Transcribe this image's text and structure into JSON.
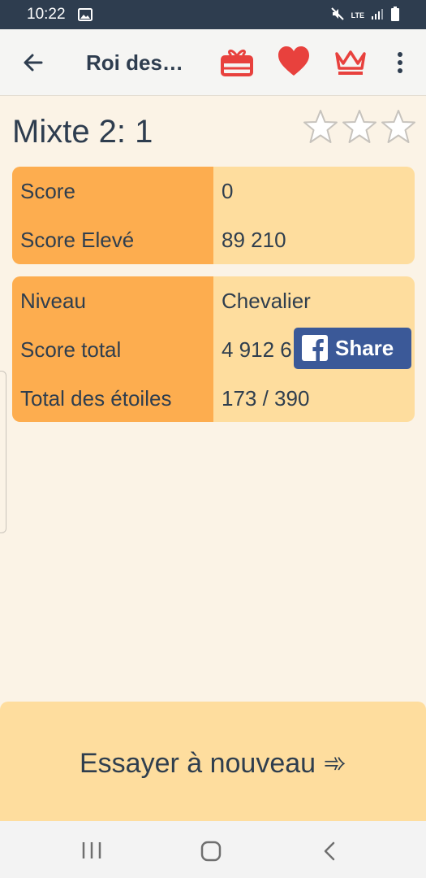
{
  "status_bar": {
    "time": "10:22",
    "network": "LTE",
    "icons": [
      "gallery-icon",
      "mute-icon",
      "signal-icon",
      "battery-icon"
    ]
  },
  "app_bar": {
    "title": "Roi des…",
    "icons": [
      "back-arrow-icon",
      "gift-icon",
      "heart-icon",
      "crown-icon",
      "more-vert-icon"
    ],
    "accent_color": "#e8413d"
  },
  "level": {
    "title": "Mixte 2: 1",
    "stars_earned": 0,
    "stars_total": 3
  },
  "score_card": {
    "rows": [
      {
        "label": "Score",
        "value": "0"
      },
      {
        "label": "Score Elevé",
        "value": "89 210"
      }
    ]
  },
  "stats_card": {
    "rows": [
      {
        "label": "Niveau",
        "value": "Chevalier"
      },
      {
        "label": "Score total",
        "value": "4 912 6"
      },
      {
        "label": "Total des étoiles",
        "value": "173 / 390"
      }
    ]
  },
  "share_button": {
    "label": "Share",
    "color": "#3b5998"
  },
  "retry_button": {
    "label": "Essayer à nouveau ➾"
  },
  "colors": {
    "background": "#fbf3e6",
    "label_column": "#fdad4f",
    "value_column": "#fedd9e",
    "status_bar": "#2e3d4f"
  }
}
